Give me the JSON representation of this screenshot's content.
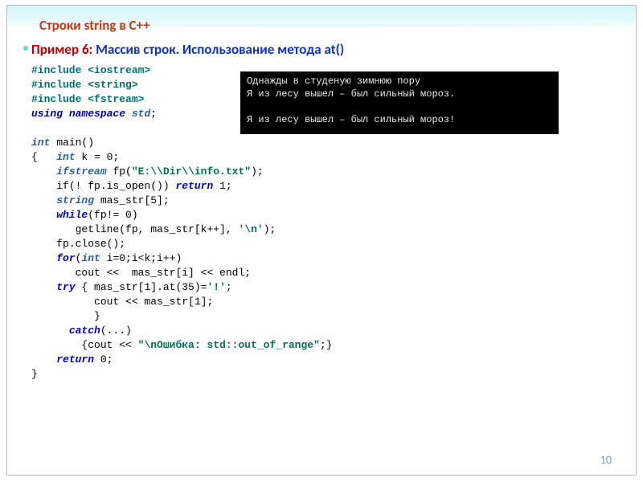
{
  "title": "Строки  string в C++",
  "example_prefix": "Пример 6: ",
  "example_text": "Массив строк. Использование метода at()",
  "console_output": "Однажды в студеную зимнюю пору\nЯ из лесу вышел – был сильный мороз.\n\nЯ из лесу вышел – был сильный мороз!",
  "page_number": "10",
  "code": {
    "inc1": "#include <iostream>",
    "inc2": "#include <string>",
    "inc3": "#include <fstream>",
    "using1": "using",
    "using2": "namespace",
    "std": "std",
    "semi": ";",
    "int_t": "int",
    "main": " main()",
    "br_open": "{",
    "k_decl": " k = 0;",
    "ifstream": "ifstream",
    "fp_decl": " fp(",
    "fp_path": "\"E:\\\\Dir\\\\info.txt\"",
    "fp_close": ");",
    "if_open": "if(! fp.is_open()) ",
    "return": "return",
    "ret1": " 1;",
    "string_t": "string",
    "mas_decl": " mas_str[5];",
    "while": "while",
    "while_cond": "(fp!= 0)",
    "getline": "   getline(fp, mas_str[k++], ",
    "newline_char": "'\\n'",
    "getline_end": ");",
    "fpclose": "fp.close();",
    "for": "for",
    "for_cond": "(",
    "for_int": "int",
    "for_body": " i=0;i<k;i++)",
    "cout1": "   cout <<  mas_str[i] << endl;",
    "try": "try",
    "try_body": " { mas_str[1].at(35)=",
    "excl": "'!'",
    "try_end": ";",
    "cout2": "      cout << mas_str[1];",
    "brace_r": "      }",
    "catch": "catch",
    "catch_args": "(...)",
    "catch_body1": "  {cout << ",
    "err_str": "\"\\nОшибка: std::out_of_range\"",
    "catch_body2": ";}",
    "ret0": " 0;",
    "br_close": "}"
  }
}
